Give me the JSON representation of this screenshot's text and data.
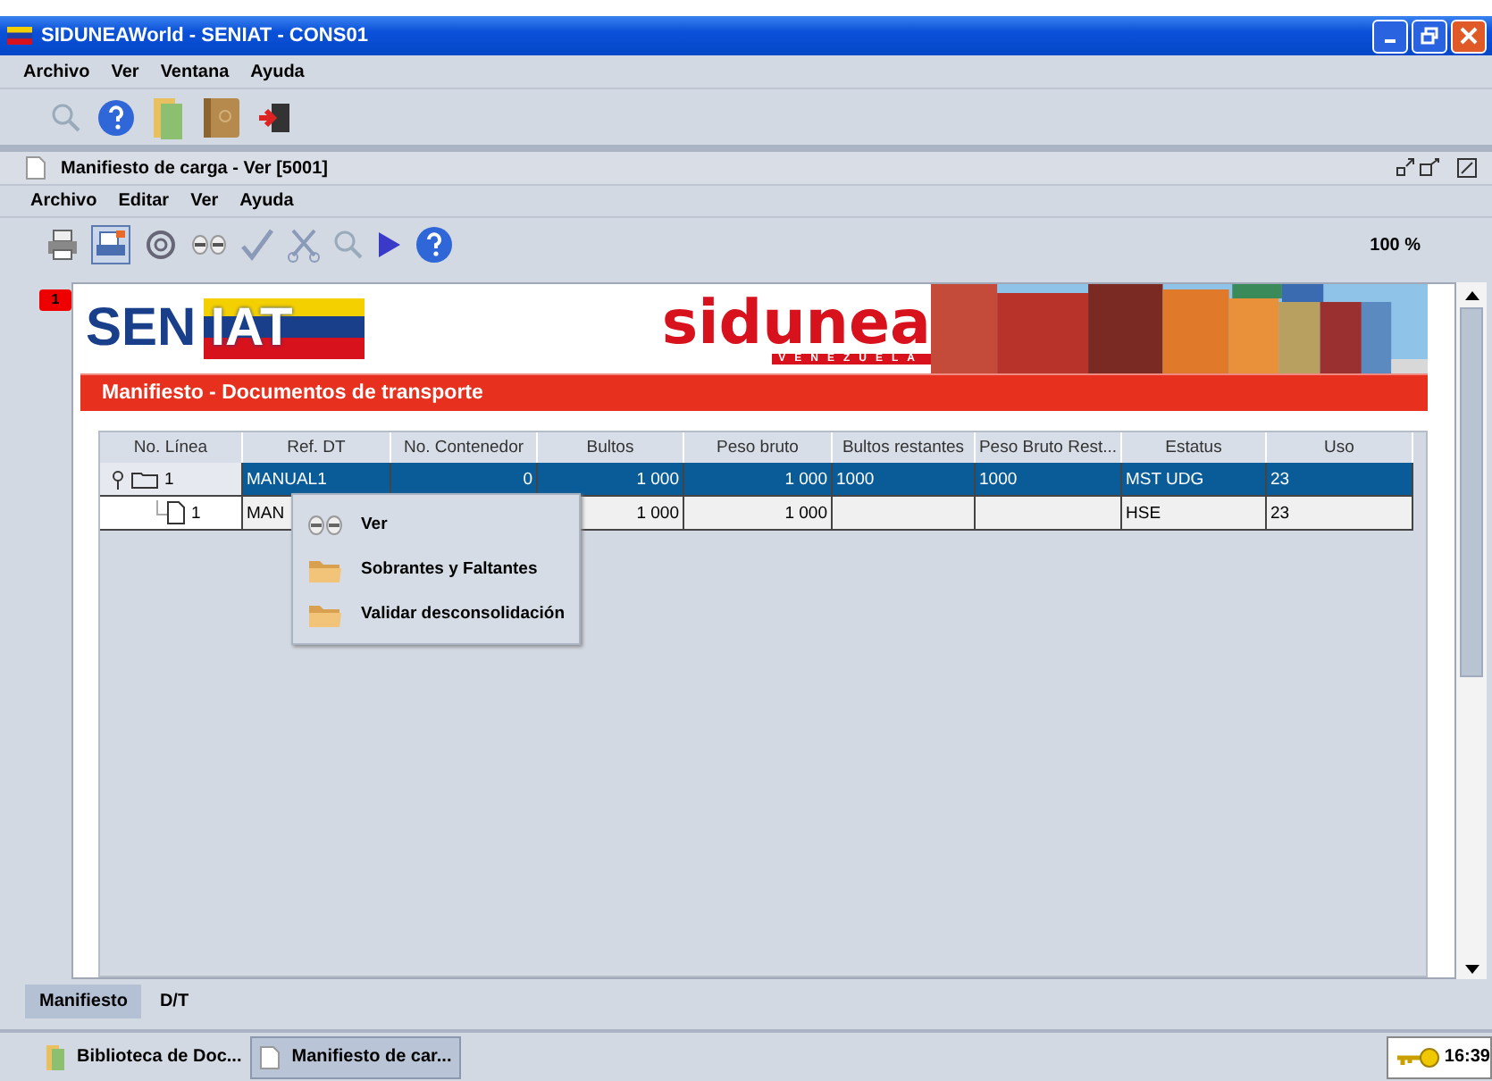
{
  "window": {
    "title": "SIDUNEAWorld - SENIAT - CONS01"
  },
  "menu": [
    "Archivo",
    "Ver",
    "Ventana",
    "Ayuda"
  ],
  "frame": {
    "title": "Manifiesto de carga - Ver [5001]",
    "menu": [
      "Archivo",
      "Editar",
      "Ver",
      "Ayuda"
    ],
    "zoom": "100 %"
  },
  "page_badge": "1",
  "banner": {
    "seniat_left": "SEN",
    "seniat_right": "IAT",
    "sidunea": "sidunea",
    "country": "VENEZUELA",
    "heading": "Manifiesto - Documentos de transporte"
  },
  "table": {
    "columns": [
      "No. Línea",
      "Ref. DT",
      "No. Contenedor",
      "Bultos",
      "Peso bruto",
      "Bultos restantes",
      "Peso Bruto Rest...",
      "Estatus",
      "Uso"
    ],
    "rows": [
      {
        "selected": true,
        "expanded": true,
        "cells": [
          "1",
          "MANUAL1",
          "0",
          "1 000",
          "1 000",
          "1000",
          "1000",
          "MST UDG",
          "23"
        ],
        "children": [
          {
            "selected": false,
            "cells": [
              "1",
              "MAN",
              null,
              "1 000",
              "1 000",
              null,
              null,
              "HSE",
              "23"
            ]
          }
        ]
      }
    ]
  },
  "context_menu": [
    "Ver",
    "Sobrantes y Faltantes",
    "Validar desconsolidación"
  ],
  "tabs": [
    {
      "label": "Manifiesto",
      "selected": true
    },
    {
      "label": "D/T",
      "selected": false
    }
  ],
  "taskbar": {
    "items": [
      {
        "label": "Biblioteca de Doc...",
        "selected": false
      },
      {
        "label": "Manifiesto de car...",
        "selected": true
      }
    ],
    "clock": "16:39"
  }
}
